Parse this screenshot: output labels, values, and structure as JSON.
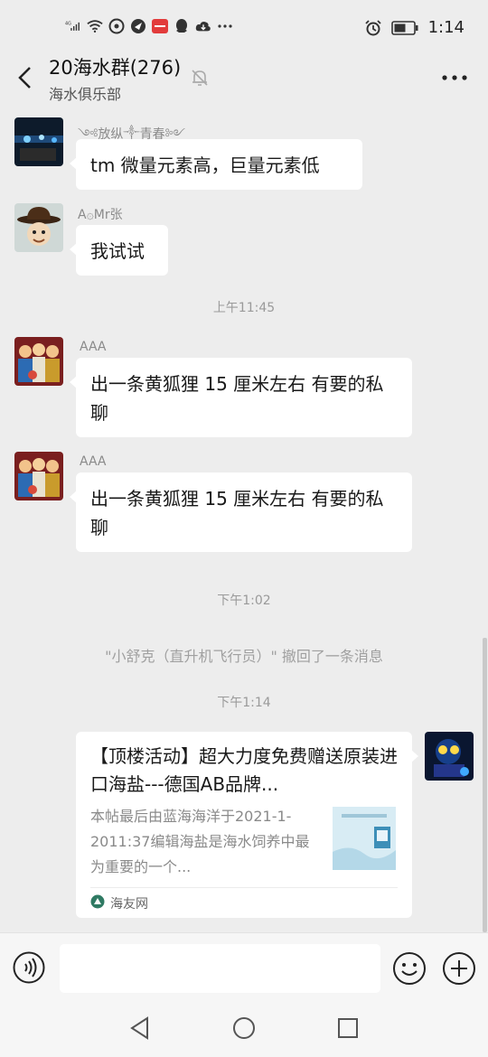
{
  "status_bar": {
    "network_label": "4G",
    "time": "1:14",
    "icons": [
      "signal-icon",
      "wifi-icon",
      "location-icon",
      "app-icon",
      "notification-app-icon",
      "qq-icon",
      "cloud-icon",
      "more-dots-icon",
      "alarm-icon",
      "battery-icon"
    ]
  },
  "header": {
    "title": "20海水群(276)",
    "subtitle": "海水俱乐部",
    "muted": true
  },
  "messages": [
    {
      "sender": "༺放纵༒青春༻",
      "text": "tm 微量元素高，巨量元素低"
    },
    {
      "sender": "A۞Mr张",
      "text": "我试试"
    },
    {
      "time": "上午11:45"
    },
    {
      "sender": "AAA",
      "text": "出一条黄狐狸 15 厘米左右  有要的私聊"
    },
    {
      "sender": "AAA",
      "text": "出一条黄狐狸 15 厘米左右  有要的私聊"
    },
    {
      "time": "下午1:02"
    },
    {
      "system": "\"小舒克（直升机飞行员）\" 撤回了一条消息"
    },
    {
      "time": "下午1:14"
    }
  ],
  "link_card": {
    "title": "【顶楼活动】超大力度免费赠送原装进口海盐---德国AB品牌...",
    "description": "本帖最后由蓝海海洋于2021-1-2011:37编辑海盐是海水饲养中最为重要的一个...",
    "source": "海友网"
  },
  "input_bar": {
    "placeholder": ""
  },
  "colors": {
    "background": "#ededed",
    "bubble": "#ffffff",
    "meta_text": "#8a8a8a"
  }
}
